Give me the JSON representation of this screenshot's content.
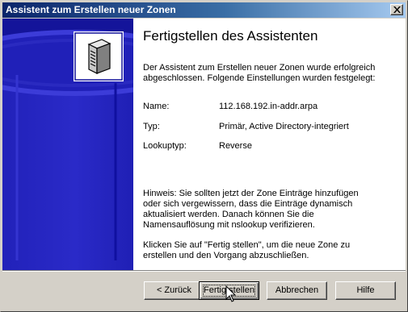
{
  "window": {
    "title": "Assistent zum Erstellen neuer Zonen",
    "close_glyph": "×"
  },
  "page": {
    "heading": "Fertigstellen des Assistenten",
    "intro": "Der Assistent zum Erstellen neuer Zonen wurde erfolgreich abgeschlossen. Folgende Einstellungen wurden festgelegt:",
    "settings": [
      {
        "label": "Name:",
        "value": "112.168.192.in-addr.arpa"
      },
      {
        "label": "Typ:",
        "value": "Primär, Active Directory-integriert"
      },
      {
        "label": "Lookuptyp:",
        "value": "Reverse"
      }
    ],
    "hint": "Hinweis: Sie sollten jetzt der Zone Einträge hinzufügen oder sich vergewissern, dass die Einträge dynamisch aktualisiert werden. Danach können Sie die Namensauflösung mit nslookup verifizieren.",
    "finish_text": "Klicken Sie auf \"Fertig stellen\", um die neue Zone zu erstellen und den Vorgang abzuschließen."
  },
  "buttons": {
    "back": "< Zurück",
    "finish": "Fertig stellen",
    "cancel": "Abbrechen",
    "help": "Hilfe"
  },
  "colors": {
    "titlebar_start": "#0a246a",
    "titlebar_end": "#a6caf0",
    "banner_blue": "#14149a",
    "dialog_face": "#d4d0c8"
  },
  "icons": [
    "close-icon",
    "server-icon",
    "cursor-icon"
  ]
}
